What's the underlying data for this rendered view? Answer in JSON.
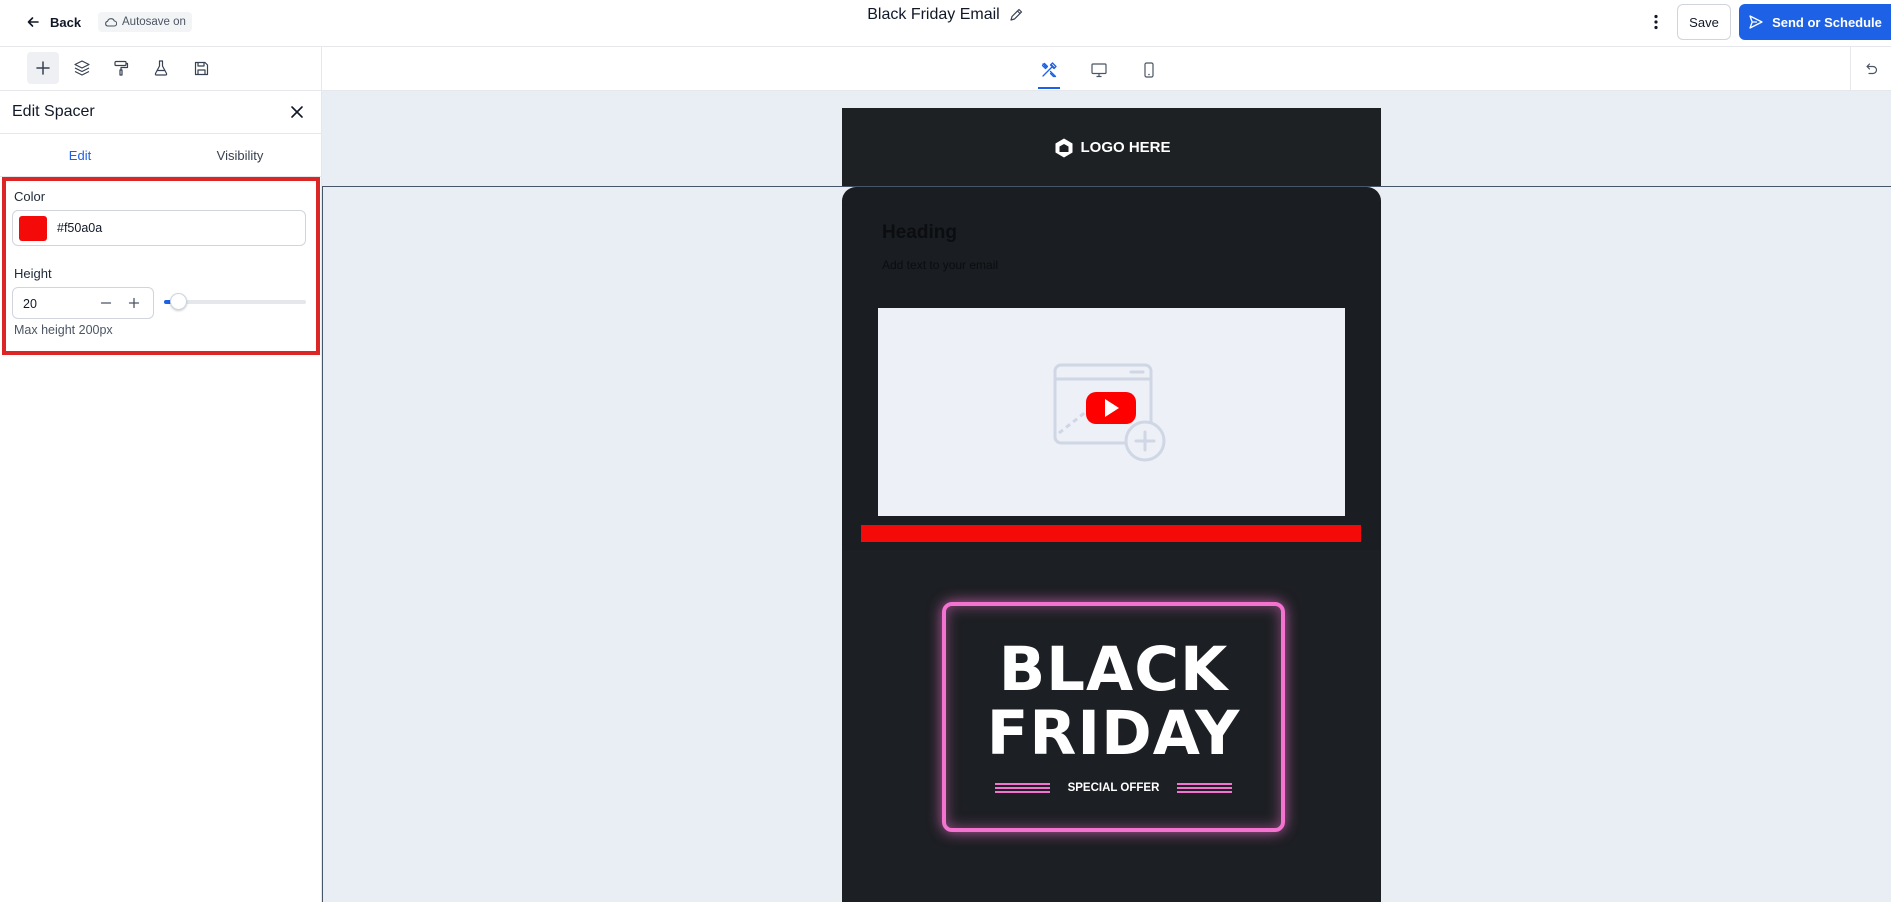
{
  "topbar": {
    "back_label": "Back",
    "autosave_label": "Autosave on",
    "title": "Black Friday Email",
    "save_label": "Save",
    "send_label": "Send or Schedule"
  },
  "toolbar": {
    "left_tools": [
      "plus-icon",
      "layers-icon",
      "paint-roller-icon",
      "flask-icon",
      "save-template-icon"
    ],
    "view_modes": [
      "design-tools-icon",
      "desktop-icon",
      "mobile-icon"
    ]
  },
  "panel": {
    "title": "Edit Spacer",
    "tabs": [
      {
        "label": "Edit",
        "active": true
      },
      {
        "label": "Visibility",
        "active": false
      }
    ],
    "color_label": "Color",
    "color_value": "#f50a0a",
    "height_label": "Height",
    "height_value": "20",
    "height_fraction": 0.1,
    "height_hint": "Max height 200px"
  },
  "email": {
    "logo_text": "LOGO HERE",
    "heading": "Heading",
    "body_text": "Add text to your email",
    "spacer_color": "#f50a0a",
    "banner_line1": "BLACK",
    "banner_line2": "FRIDAY",
    "banner_offer": "SPECIAL OFFER"
  },
  "colors": {
    "accent": "#1d62e6",
    "highlight": "#dc2626",
    "neon": "#f472d0"
  }
}
